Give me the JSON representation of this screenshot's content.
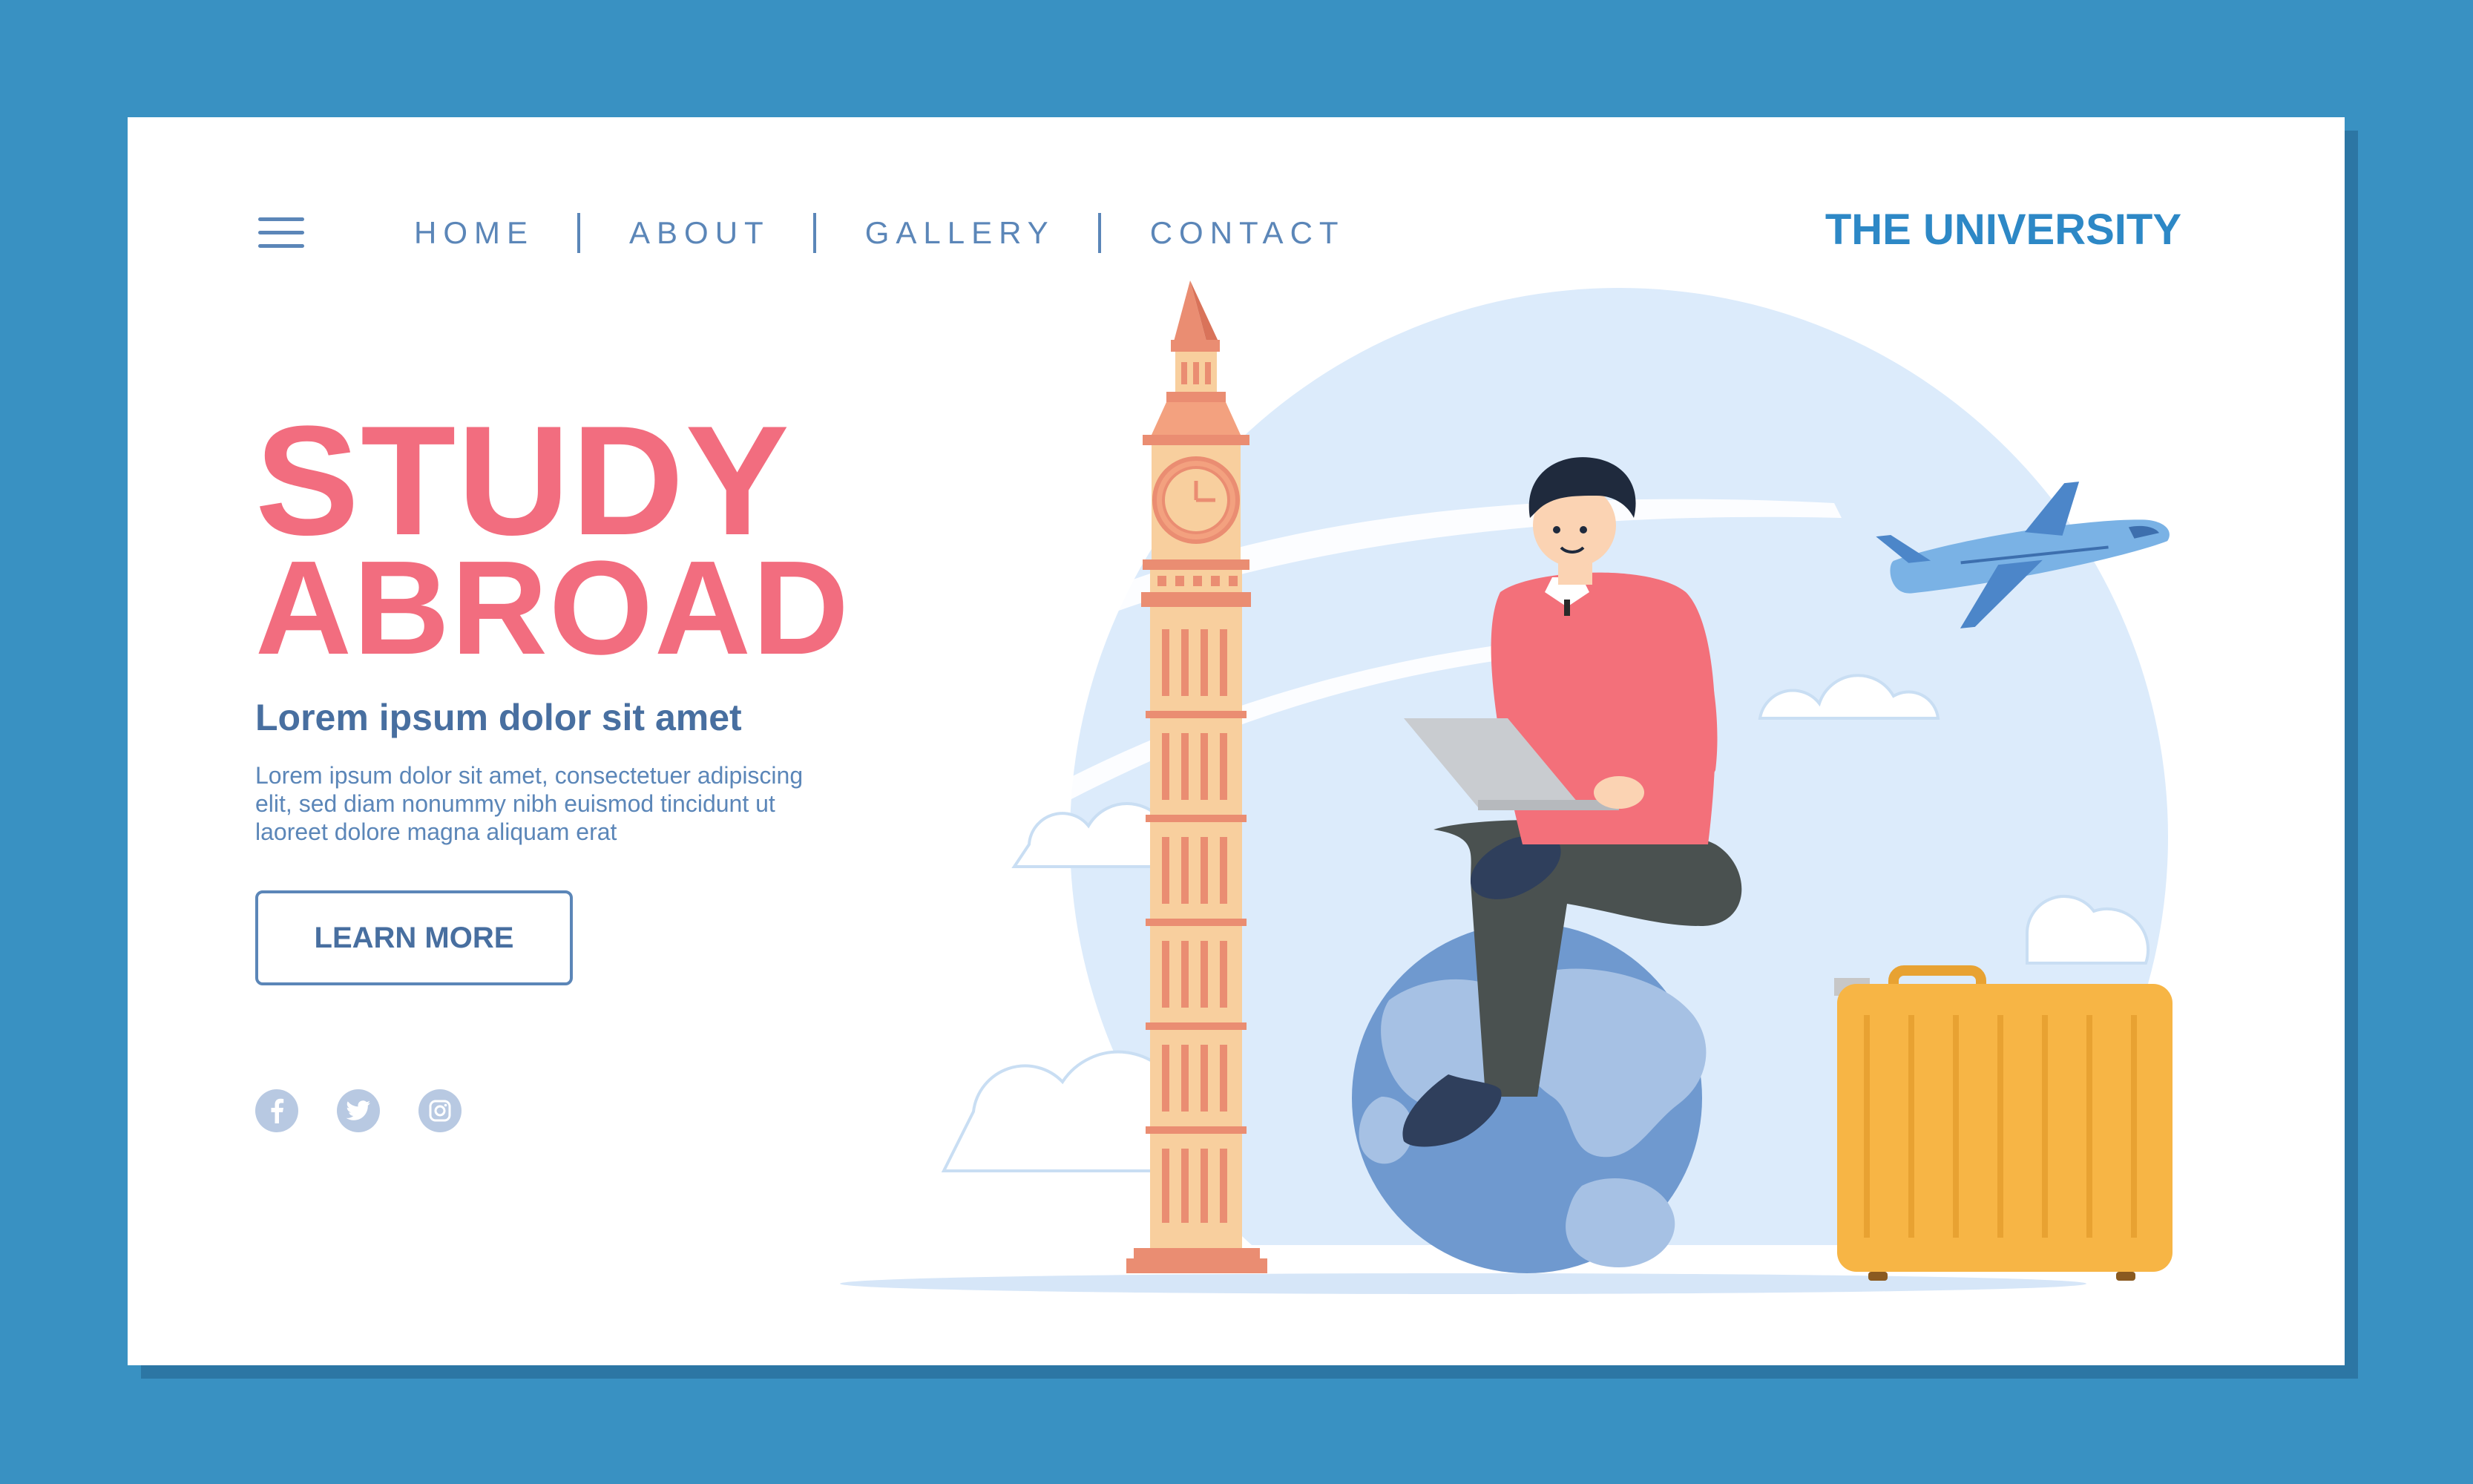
{
  "nav": {
    "items": [
      {
        "label": "HOME"
      },
      {
        "label": "ABOUT"
      },
      {
        "label": "GALLERY"
      },
      {
        "label": "CONTACT"
      }
    ]
  },
  "brand": "THE UNIVERSITY",
  "hero": {
    "title_line1": "STUDY",
    "title_line2": "ABROAD",
    "subheading": "Lorem ipsum dolor sit amet",
    "body": "Lorem ipsum dolor sit amet, consectetuer adipiscing elit, sed diam nonummy nibh euismod tincidunt ut laoreet dolore magna aliquam erat",
    "cta_label": "LEARN MORE"
  },
  "social": [
    {
      "icon": "facebook-icon"
    },
    {
      "icon": "twitter-icon"
    },
    {
      "icon": "instagram-icon"
    }
  ],
  "colors": {
    "background": "#3991c2",
    "title": "#f26d7f",
    "nav": "#5b86b8",
    "brand": "#2d88c6",
    "tower": "#f8cf9e",
    "tower_trim": "#ea8d72",
    "globe": "#6f99cf",
    "suitcase": "#f7b545",
    "sweater": "#f3707a",
    "plane": "#7ab2e5"
  }
}
